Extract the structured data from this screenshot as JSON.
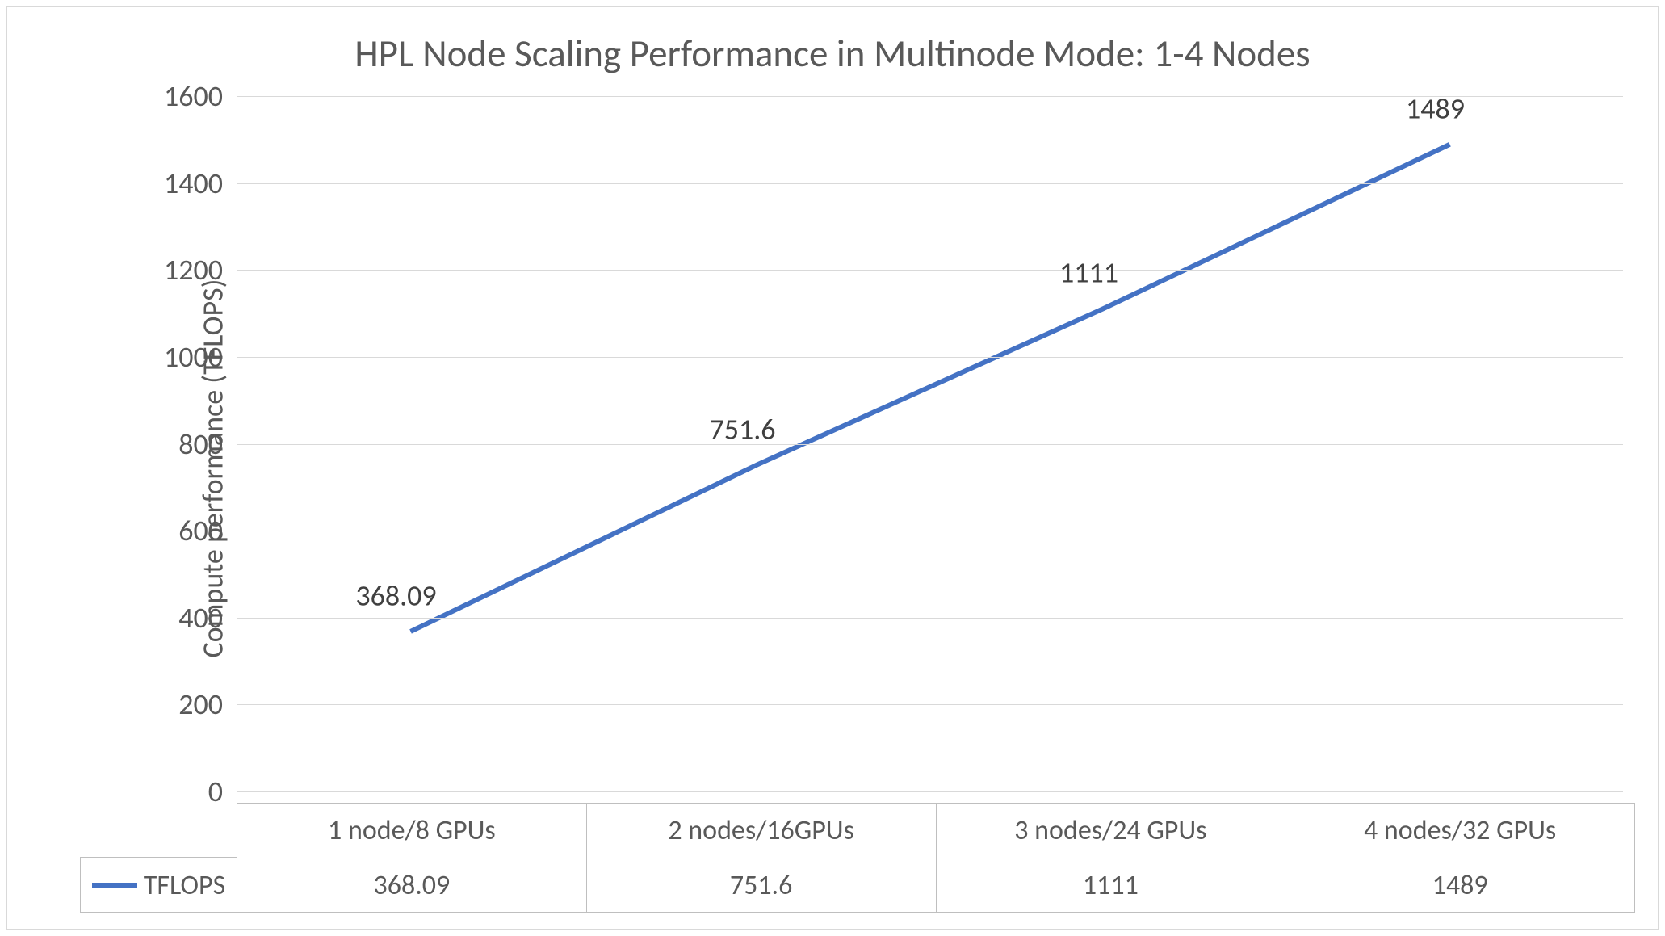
{
  "chart_data": {
    "type": "line",
    "title": "HPL Node Scaling Performance in Multinode Mode: 1-4 Nodes",
    "ylabel": "Compute performance (TFLOPS)",
    "xlabel": "",
    "categories": [
      "1 node/8 GPUs",
      "2 nodes/16GPUs",
      "3 nodes/24 GPUs",
      "4 nodes/32 GPUs"
    ],
    "series": [
      {
        "name": "TFLOPS",
        "values": [
          368.09,
          751.6,
          1111,
          1489
        ]
      }
    ],
    "data_labels": [
      "368.09",
      "751.6",
      "1111",
      "1489"
    ],
    "ylim": [
      0,
      1600
    ],
    "y_ticks": [
      0,
      200,
      400,
      600,
      800,
      1000,
      1200,
      1400,
      1600
    ],
    "line_color": "#4472c4"
  },
  "table": {
    "legend_label": "TFLOPS",
    "header_cells": [
      "1 node/8 GPUs",
      "2 nodes/16GPUs",
      "3 nodes/24 GPUs",
      "4 nodes/32 GPUs"
    ],
    "value_cells": [
      "368.09",
      "751.6",
      "1111",
      "1489"
    ]
  }
}
